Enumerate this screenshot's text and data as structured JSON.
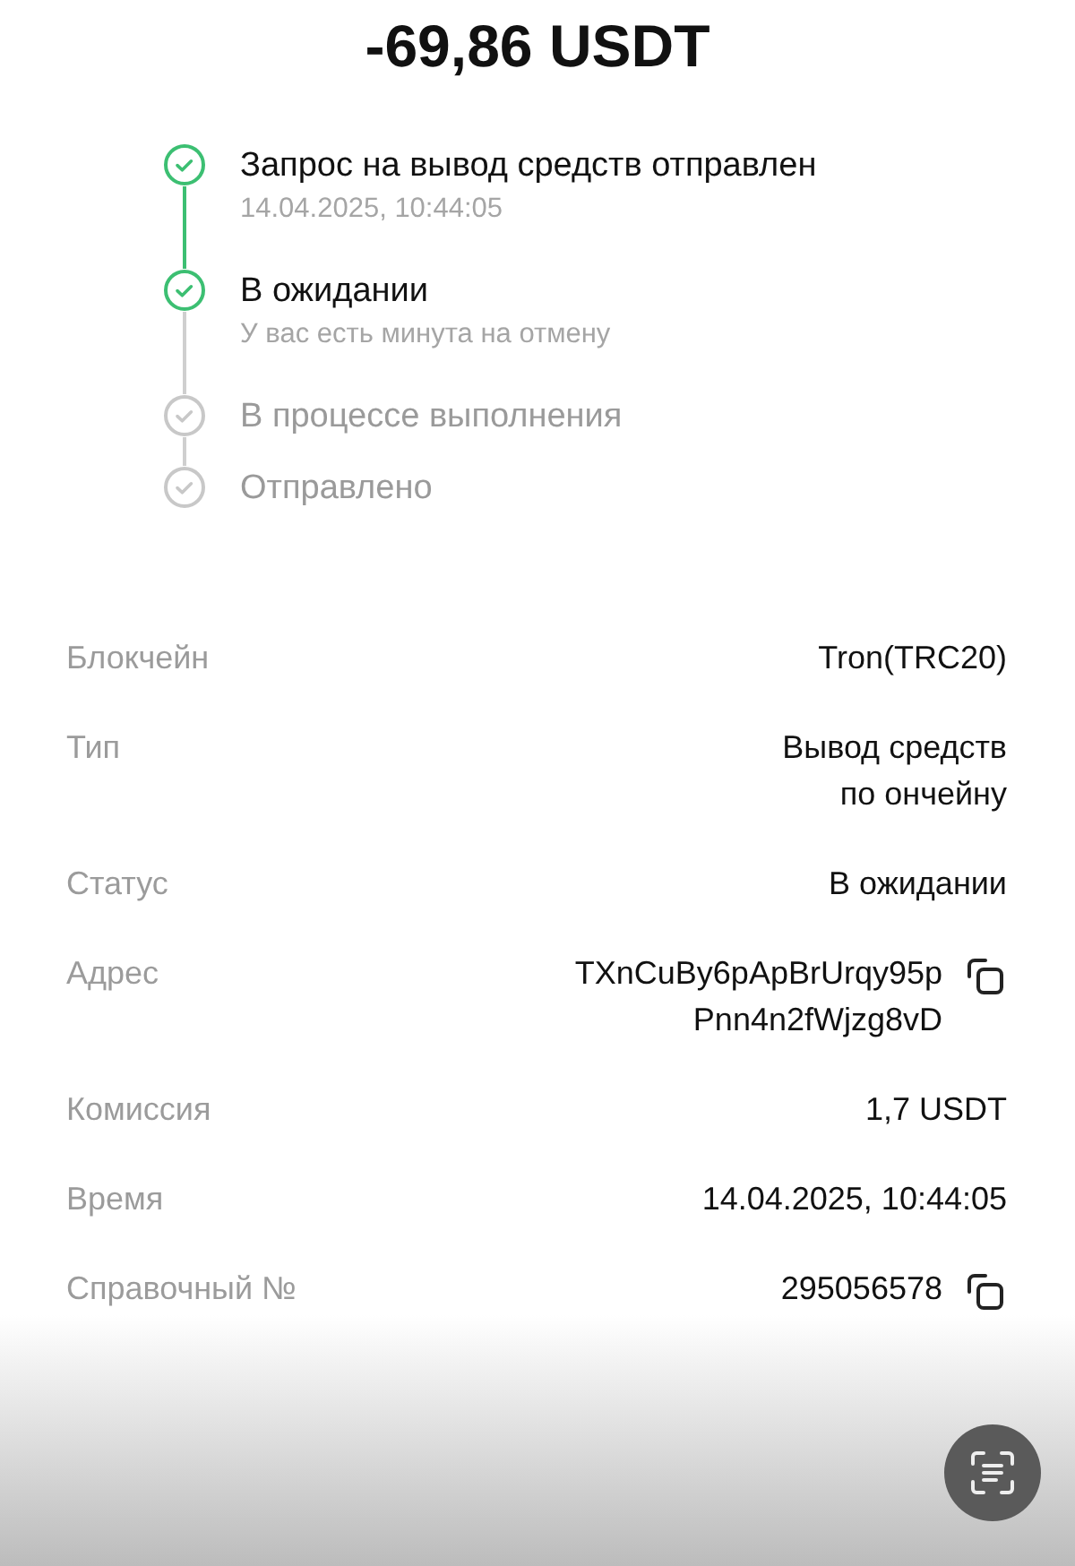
{
  "amount": "-69,86 USDT",
  "steps": [
    {
      "title": "Запрос на вывод средств отправлен",
      "subtitle": "14.04.2025, 10:44:05",
      "done": true
    },
    {
      "title": "В ожидании",
      "subtitle": "У вас есть минута на отмену",
      "done": true
    },
    {
      "title": "В процессе выполнения",
      "done": false
    },
    {
      "title": "Отправлено",
      "done": false
    }
  ],
  "details": [
    {
      "label": "Блокчейн",
      "value": [
        "Tron(TRC20)"
      ],
      "copy": false
    },
    {
      "label": "Тип",
      "value": [
        "Вывод средств",
        "по ончейну"
      ],
      "copy": false
    },
    {
      "label": "Статус",
      "value": [
        "В ожидании"
      ],
      "copy": false
    },
    {
      "label": "Адрес",
      "value": [
        "TXnCuBy6pApBrUrqy95p",
        "Pnn4n2fWjzg8vD"
      ],
      "copy": true
    },
    {
      "label": "Комиссия",
      "value": [
        "1,7 USDT"
      ],
      "copy": false
    },
    {
      "label": "Время",
      "value": [
        "14.04.2025, 10:44:05"
      ],
      "copy": false
    },
    {
      "label": "Справочный №",
      "value": [
        "295056578"
      ],
      "copy": true
    }
  ]
}
